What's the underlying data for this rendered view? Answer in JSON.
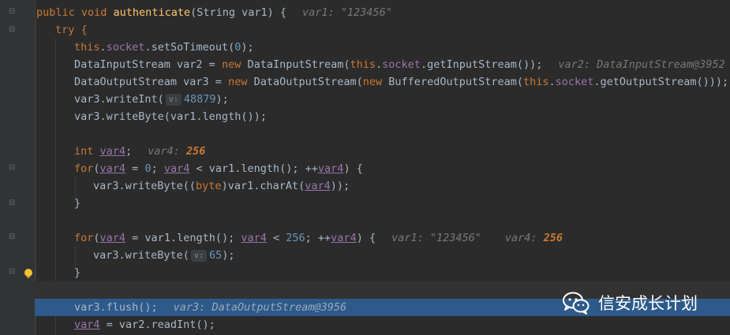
{
  "editor": {
    "lines": [
      {
        "kind": "sig",
        "method": "authenticate",
        "params": "String var1",
        "hint": "var1: \"123456\""
      },
      {
        "kind": "plain",
        "text": "try {"
      },
      {
        "kind": "plain",
        "text": "this.socket.setSoTimeout(0);"
      },
      {
        "kind": "plain",
        "text": "DataInputStream var2 = new DataInputStream(this.socket.getInputStream());",
        "hint": "var2: DataInputStream@3952"
      },
      {
        "kind": "plain",
        "text": "DataOutputStream var3 = new DataOutputStream(new BufferedOutputStream(this.socket.getOutputStream()));"
      },
      {
        "kind": "plain",
        "text": "var3.writeInt(",
        "inlay": "v:",
        "after": "48879);"
      },
      {
        "kind": "plain",
        "text": "var3.writeByte(var1.length());"
      },
      {
        "kind": "plain",
        "text": ""
      },
      {
        "kind": "plain",
        "text": "int var4;",
        "hint": "var4: 256"
      },
      {
        "kind": "plain",
        "text": "for(var4 = 0; var4 < var1.length(); ++var4) {"
      },
      {
        "kind": "plain",
        "text": "var3.writeByte((byte)var1.charAt(var4));"
      },
      {
        "kind": "plain",
        "text": "}"
      },
      {
        "kind": "plain",
        "text": ""
      },
      {
        "kind": "plain",
        "text": "for(var4 = var1.length(); var4 < 256; ++var4) {",
        "hint": "var1: \"123456\"",
        "hint2": "var4: 256"
      },
      {
        "kind": "plain",
        "text": "var3.writeByte(",
        "inlay": "v:",
        "after": "65);"
      },
      {
        "kind": "plain",
        "text": "}"
      },
      {
        "kind": "plain",
        "text": ""
      },
      {
        "kind": "plain",
        "text": "var3.flush();",
        "hint": "var3: DataOutputStream@3956"
      },
      {
        "kind": "plain",
        "text": "var4 = var2.readInt();"
      }
    ]
  },
  "watermark": {
    "text": "信安成长计划"
  },
  "colors": {
    "background": "#2b2b2b",
    "keyword": "#cc7832",
    "method": "#ffc66d",
    "field": "#9876aa",
    "number": "#6897bb",
    "execution_line": "#2d5a8a"
  }
}
